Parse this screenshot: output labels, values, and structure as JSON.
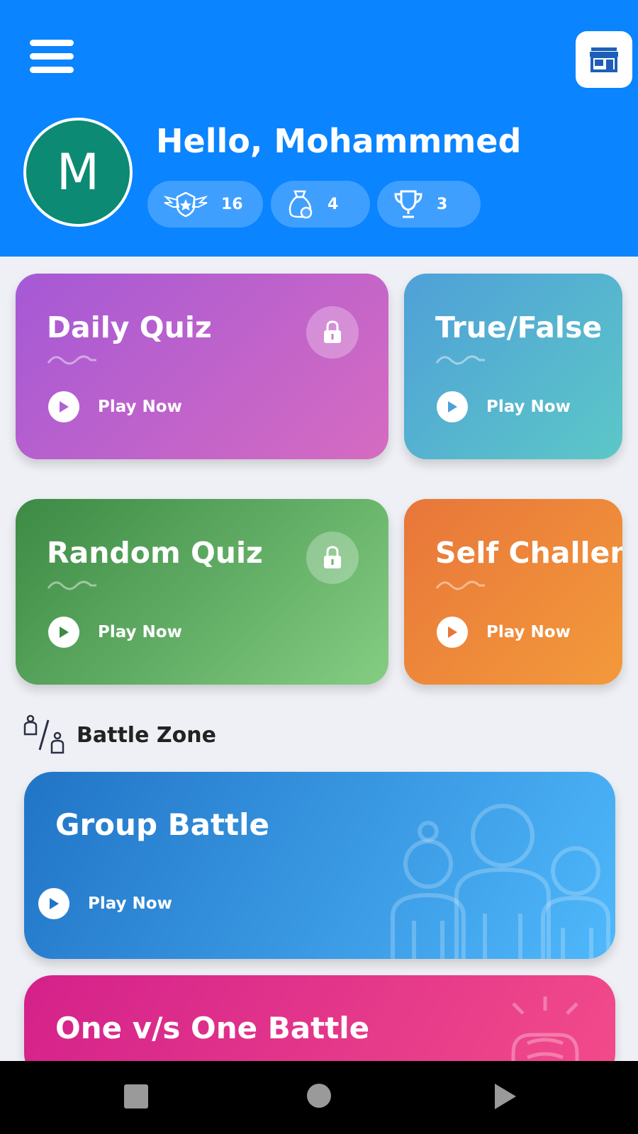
{
  "header": {
    "greeting": "Hello, Mohammmed",
    "avatar_initial": "M",
    "stats": [
      {
        "icon": "rank-badge-icon",
        "value": "16"
      },
      {
        "icon": "coin-bag-icon",
        "value": "4"
      },
      {
        "icon": "trophy-icon",
        "value": "3"
      }
    ]
  },
  "quiz_cards": [
    {
      "title": "Daily Quiz",
      "action": "Play Now",
      "locked": true
    },
    {
      "title": "True/False",
      "action": "Play Now",
      "locked": false
    },
    {
      "title": "Random Quiz",
      "action": "Play Now",
      "locked": true
    },
    {
      "title": "Self Challenge",
      "action": "Play Now",
      "locked": false
    }
  ],
  "battle_zone": {
    "heading": "Battle Zone",
    "cards": [
      {
        "title": "Group Battle",
        "action": "Play Now"
      },
      {
        "title": "One v/s One Battle"
      }
    ]
  },
  "colors": {
    "header_bg": "#0a84ff",
    "daily_quiz": [
      "#a559d6",
      "#d66bc1"
    ],
    "true_false": [
      "#4fa0d8",
      "#5cc7c7"
    ],
    "random_quiz": [
      "#3c8a44",
      "#84cd83"
    ],
    "self_challenge": [
      "#e8763a",
      "#f39a3b"
    ],
    "group_battle": [
      "#2174c6",
      "#4fb8fb"
    ],
    "one_vs_one": [
      "#d4218b",
      "#f24b8a"
    ]
  }
}
